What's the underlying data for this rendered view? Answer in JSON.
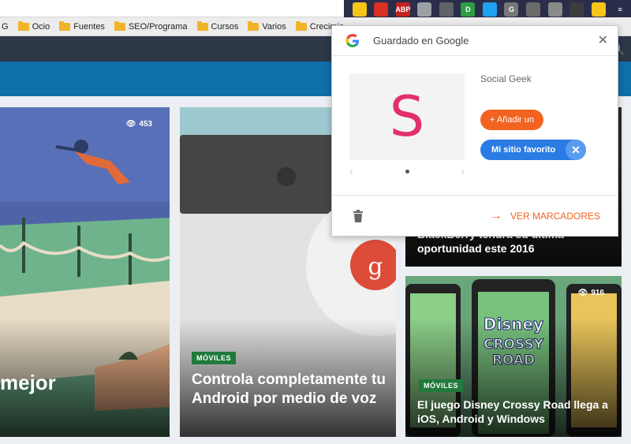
{
  "browser": {
    "bookmarks": [
      {
        "label": "Ocio"
      },
      {
        "label": "Fuentes"
      },
      {
        "label": "SEO/Programa"
      },
      {
        "label": "Cursos"
      },
      {
        "label": "Varios"
      },
      {
        "label": "Crecimie"
      }
    ],
    "bookmark_partial_left": "G",
    "extensions": [
      {
        "name": "star-icon",
        "color": "#f5c518",
        "label": ""
      },
      {
        "name": "red-ext-icon",
        "color": "#d93025",
        "label": ""
      },
      {
        "name": "abp-icon",
        "color": "#c5221f",
        "label": "ABP"
      },
      {
        "name": "grey-ext-icon",
        "color": "#9aa0a6",
        "label": ""
      },
      {
        "name": "refresh-ext-icon",
        "color": "#5f6368",
        "label": ""
      },
      {
        "name": "green-ext-icon",
        "color": "#2e9e44",
        "label": "D"
      },
      {
        "name": "twitter-icon",
        "color": "#1da1f2",
        "label": ""
      },
      {
        "name": "gplus-ext-icon",
        "color": "#777777",
        "label": "G"
      },
      {
        "name": "grid-ext-icon",
        "color": "#6b6b6b",
        "label": ""
      },
      {
        "name": "bae-ext-icon",
        "color": "#8a8a8a",
        "label": ""
      },
      {
        "name": "pocket-icon",
        "color": "#3c3c3c",
        "label": ""
      },
      {
        "name": "bookmark-star-icon",
        "color": "#f5c518",
        "label": ""
      },
      {
        "name": "menu-icon",
        "color": "#2b2e4a",
        "label": "≡"
      }
    ]
  },
  "cards": {
    "left": {
      "views": "",
      "headline": "mejor"
    },
    "middle": {
      "tag": "MÓVILES",
      "headline": "Controla completamente tu Android por medio de voz"
    },
    "right_top": {
      "headline": "BlackBerry tendrá su última oportunidad este 2016"
    },
    "right_bottom": {
      "views": "916",
      "tag": "MÓVILES",
      "headline": "El juego Disney Crossy Road llega a iOS, Android y Windows"
    },
    "left_views": "453"
  },
  "popup": {
    "title": "Guardado en Google",
    "site_name": "Social Geek",
    "thumb_letter": "S",
    "add_button": "+ Añadir un",
    "chip_label": "Mi sitio favorito",
    "view_bookmarks": "VER MARCADORES",
    "colors": {
      "accent": "#f26322",
      "chip": "#2a7be4",
      "letter": "#e2306c"
    }
  }
}
